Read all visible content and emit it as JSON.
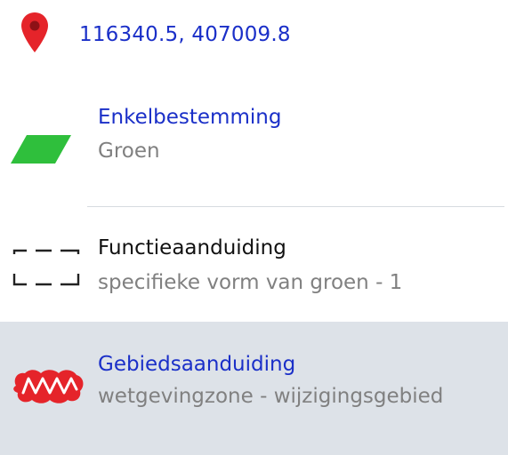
{
  "location": {
    "coordinates": "116340.5, 407009.8",
    "icon": "map-pin-icon",
    "icon_color": "#e5242a"
  },
  "items": [
    {
      "title": "Enkelbestemming",
      "subtitle": "Groen",
      "icon": "green-parallelogram-icon",
      "icon_color": "#2fbf3c",
      "selected": false
    },
    {
      "title": "Functieaanduiding",
      "subtitle": "specifieke vorm van groen - 1",
      "icon": "dashed-rectangle-icon",
      "icon_color": "#222222",
      "selected": false
    },
    {
      "title": "Gebiedsaanduiding",
      "subtitle": "wetgevingzone - wijzigingsgebied",
      "icon": "red-zigzag-area-icon",
      "icon_color": "#e5242a",
      "selected": true
    }
  ],
  "colors": {
    "link_blue": "#1a2fc8",
    "subtitle_gray": "#808080",
    "selected_bg": "#dde2e8"
  }
}
